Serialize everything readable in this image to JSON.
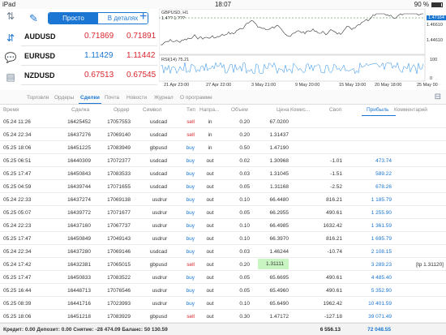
{
  "status": {
    "device": "iPad",
    "time": "18:07",
    "battery": "90 %"
  },
  "quotes": {
    "segment": {
      "simple": "Просто",
      "detailed": "В деталях"
    },
    "rows": [
      {
        "symbol": "AUDUSD",
        "bid": "0.71869",
        "ask": "0.71891",
        "bid_dir": "dn",
        "ask_dir": "dn"
      },
      {
        "symbol": "EURUSD",
        "bid": "1.11429",
        "ask": "1.11442",
        "bid_dir": "up",
        "ask_dir": "dn"
      },
      {
        "symbol": "NZDUSD",
        "bid": "0.67513",
        "ask": "0.67545",
        "bid_dir": "dn",
        "ask_dir": "dn"
      }
    ]
  },
  "chart": {
    "symbol": "GBPUSD, H1",
    "ohlc": "1.4?? 1.???",
    "price_right": [
      "1.47164",
      "1.46610",
      "1.44610"
    ],
    "rsi": "RSI(14) 75.21",
    "rsi_scale": [
      "100",
      "0"
    ],
    "xaxis": [
      "21 Apr 23:00",
      "27 Apr 22:00",
      "3 May 21:00",
      "9 May 20:00",
      "15 May 19:00",
      "20 May 18:00",
      "25 May 00"
    ]
  },
  "tabs": [
    "Торговля",
    "Ордеры",
    "Сделки",
    "Почта",
    "Новости",
    "Журнал",
    "О программе"
  ],
  "active_tab": "Сделки",
  "columns": [
    "Время",
    "Сделка",
    "Ордер",
    "Символ",
    "Тип",
    "Напра...",
    "Объем",
    "Цена",
    "Комис...",
    "Своп",
    "Прибыль",
    "Комментарий"
  ],
  "deals": [
    {
      "time": "05.24 11:26",
      "deal": "16425452",
      "order": "17057553",
      "symbol": "usdcad",
      "type": "sell",
      "dir": "in",
      "volume": "0.20",
      "price": "67.0200",
      "commission": "",
      "swap": "",
      "profit": "",
      "comment": ""
    },
    {
      "time": "05.24 22:34",
      "deal": "16437276",
      "order": "17069140",
      "symbol": "usdcad",
      "type": "sell",
      "dir": "in",
      "volume": "0.20",
      "price": "1.31437",
      "commission": "",
      "swap": "",
      "profit": "",
      "comment": ""
    },
    {
      "time": "05.25 18:06",
      "deal": "16451225",
      "order": "17083949",
      "symbol": "gbpusd",
      "type": "buy",
      "dir": "in",
      "volume": "0.50",
      "price": "1.47190",
      "commission": "",
      "swap": "",
      "profit": "",
      "comment": ""
    },
    {
      "time": "05.25 06:51",
      "deal": "16440309",
      "order": "17072377",
      "symbol": "usdcad",
      "type": "buy",
      "dir": "out",
      "volume": "0.02",
      "price": "1.30968",
      "commission": "",
      "swap": "-1.01",
      "profit": "473.74",
      "comment": ""
    },
    {
      "time": "05.25 17:47",
      "deal": "16450843",
      "order": "17083533",
      "symbol": "usdcad",
      "type": "buy",
      "dir": "out",
      "volume": "0.03",
      "price": "1.31045",
      "commission": "",
      "swap": "-1.51",
      "profit": "589.22",
      "comment": ""
    },
    {
      "time": "05.25 04:59",
      "deal": "16439744",
      "order": "17071655",
      "symbol": "usdcad",
      "type": "buy",
      "dir": "out",
      "volume": "0.05",
      "price": "1.31168",
      "commission": "",
      "swap": "-2.52",
      "profit": "678.26",
      "comment": ""
    },
    {
      "time": "05.24 22:33",
      "deal": "16437274",
      "order": "17069138",
      "symbol": "usdrur",
      "type": "buy",
      "dir": "out",
      "volume": "0.10",
      "price": "66.4480",
      "commission": "",
      "swap": "816.21",
      "profit": "1 185.79",
      "comment": ""
    },
    {
      "time": "05.25 05:07",
      "deal": "16439772",
      "order": "17071677",
      "symbol": "usdrur",
      "type": "buy",
      "dir": "out",
      "volume": "0.05",
      "price": "66.2955",
      "commission": "",
      "swap": "490.61",
      "profit": "1 255.90",
      "comment": ""
    },
    {
      "time": "05.24 22:23",
      "deal": "16437160",
      "order": "17067737",
      "symbol": "usdrur",
      "type": "buy",
      "dir": "out",
      "volume": "0.10",
      "price": "66.4985",
      "commission": "",
      "swap": "1632.42",
      "profit": "1 361.59",
      "comment": ""
    },
    {
      "time": "05.25 17:47",
      "deal": "16450849",
      "order": "17049143",
      "symbol": "usdrur",
      "type": "buy",
      "dir": "out",
      "volume": "0.10",
      "price": "66.3970",
      "commission": "",
      "swap": "816.21",
      "profit": "1 695.79",
      "comment": ""
    },
    {
      "time": "05.24 22:34",
      "deal": "16437280",
      "order": "17069146",
      "symbol": "usdcad",
      "type": "buy",
      "dir": "out",
      "volume": "0.03",
      "price": "1.46244",
      "commission": "",
      "swap": "-10.74",
      "profit": "2 108.15",
      "comment": ""
    },
    {
      "time": "05.24 17:42",
      "deal": "16432381",
      "order": "17065015",
      "symbol": "gbpusd",
      "type": "sell",
      "dir": "out",
      "volume": "0.20",
      "price": "1.31111",
      "commission": "",
      "swap": "",
      "profit": "3 289.23",
      "comment": "[tp 1.31120]",
      "highlight": true
    },
    {
      "time": "05.25 17:47",
      "deal": "16450833",
      "order": "17083522",
      "symbol": "usdrur",
      "type": "buy",
      "dir": "out",
      "volume": "0.05",
      "price": "65.6695",
      "commission": "",
      "swap": "490.61",
      "profit": "4 485.40",
      "comment": ""
    },
    {
      "time": "05.25 16:44",
      "deal": "16448713",
      "order": "17076546",
      "symbol": "usdrur",
      "type": "buy",
      "dir": "out",
      "volume": "0.05",
      "price": "65.4960",
      "commission": "",
      "swap": "490.61",
      "profit": "5 352.90",
      "comment": ""
    },
    {
      "time": "05.25 08:39",
      "deal": "16441716",
      "order": "17023993",
      "symbol": "usdrur",
      "type": "buy",
      "dir": "out",
      "volume": "0.10",
      "price": "65.6490",
      "commission": "",
      "swap": "1962.42",
      "profit": "10 401.59",
      "comment": ""
    },
    {
      "time": "05.25 18:06",
      "deal": "16451218",
      "order": "17083929",
      "symbol": "gbpusd",
      "type": "sell",
      "dir": "out",
      "volume": "0.30",
      "price": "1.47172",
      "commission": "",
      "swap": "-127.18",
      "profit": "39 071.49",
      "comment": ""
    }
  ],
  "footer": {
    "summary": "Кредит: 0.00 Депозит: 0.00 Снятие: -28 474.09 Баланс: 50 130.59",
    "swap_total": "6 556.13",
    "profit_total": "72 048.55"
  }
}
